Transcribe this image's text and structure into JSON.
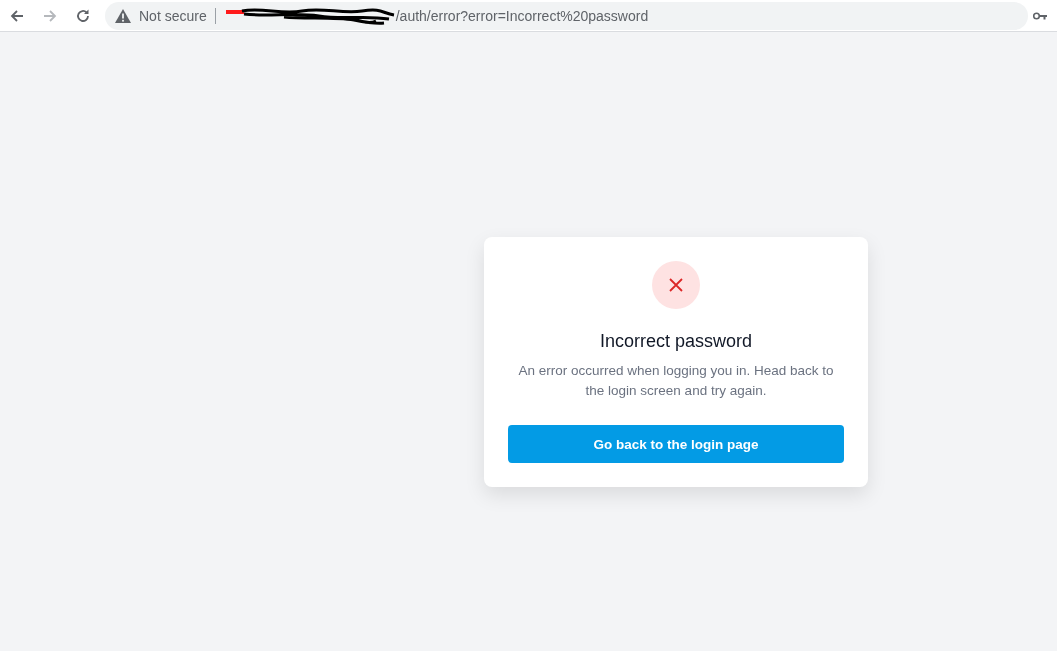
{
  "browser": {
    "back": {
      "disabled": false
    },
    "forward": {
      "disabled": true
    },
    "security": "Not secure",
    "url": "/auth/error?error=Incorrect%20password"
  },
  "card": {
    "title": "Incorrect password",
    "message": "An error occurred when logging you in. Head back to the login screen and try again.",
    "button": "Go back to the login page"
  }
}
